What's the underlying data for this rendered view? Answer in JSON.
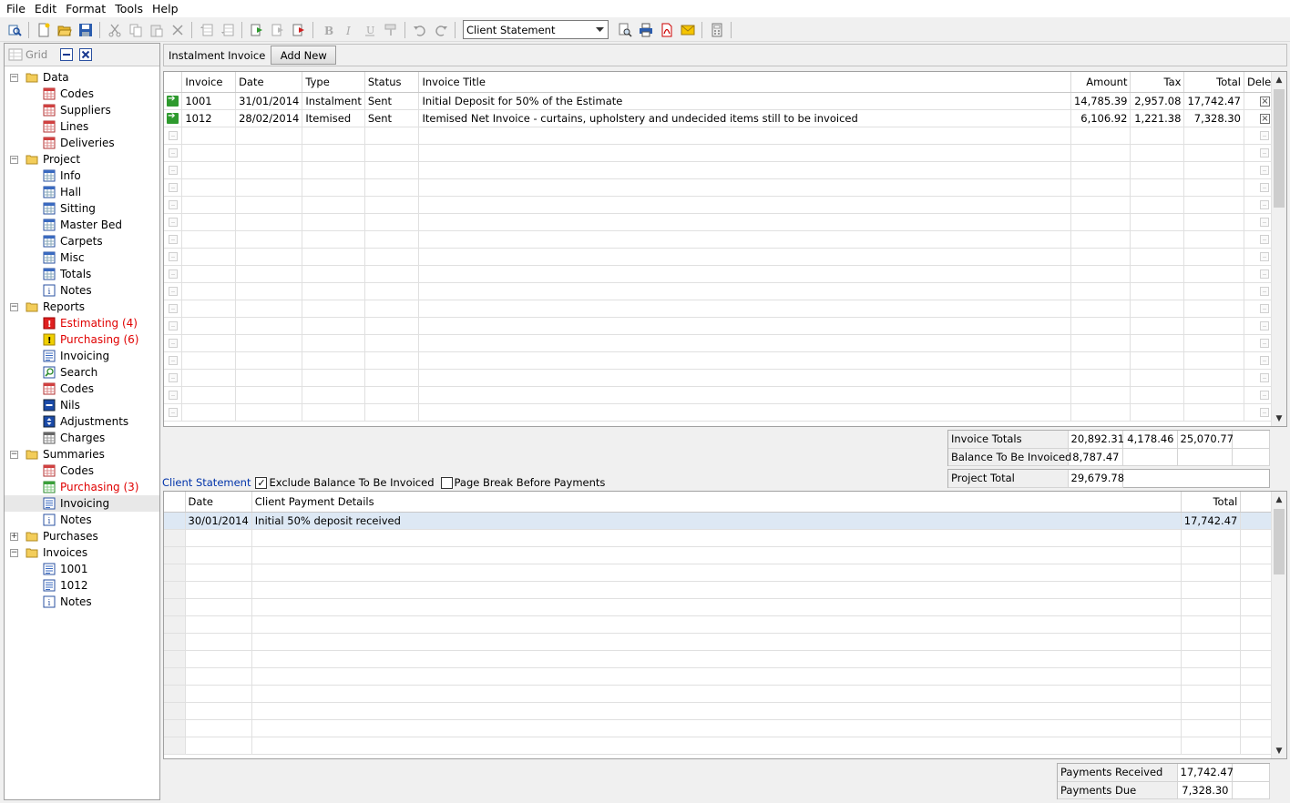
{
  "menu": [
    "File",
    "Edit",
    "Format",
    "Tools",
    "Help"
  ],
  "toolbar": {
    "report_select": "Client Statement"
  },
  "left": {
    "grid_label": "Grid",
    "tree": [
      {
        "label": "Data",
        "level": 0,
        "exp": "-",
        "icon": "folder"
      },
      {
        "label": "Codes",
        "level": 1,
        "icon": "red-grid"
      },
      {
        "label": "Suppliers",
        "level": 1,
        "icon": "red-grid"
      },
      {
        "label": "Lines",
        "level": 1,
        "icon": "red-grid"
      },
      {
        "label": "Deliveries",
        "level": 1,
        "icon": "red-grid"
      },
      {
        "label": "Project",
        "level": 0,
        "exp": "-",
        "icon": "folder"
      },
      {
        "label": "Info",
        "level": 1,
        "icon": "blue-grid"
      },
      {
        "label": "Hall",
        "level": 1,
        "icon": "blue-grid"
      },
      {
        "label": "Sitting",
        "level": 1,
        "icon": "blue-grid"
      },
      {
        "label": "Master Bed",
        "level": 1,
        "icon": "blue-grid"
      },
      {
        "label": "Carpets",
        "level": 1,
        "icon": "blue-grid"
      },
      {
        "label": "Misc",
        "level": 1,
        "icon": "blue-grid"
      },
      {
        "label": "Totals",
        "level": 1,
        "icon": "blue-grid"
      },
      {
        "label": "Notes",
        "level": 1,
        "icon": "info"
      },
      {
        "label": "Reports",
        "level": 0,
        "exp": "-",
        "icon": "folder"
      },
      {
        "label": "Estimating (4)",
        "level": 1,
        "icon": "red-alert",
        "red": true
      },
      {
        "label": "Purchasing (6)",
        "level": 1,
        "icon": "yellow-alert",
        "red": true
      },
      {
        "label": "Invoicing",
        "level": 1,
        "icon": "doc"
      },
      {
        "label": "Search",
        "level": 1,
        "icon": "search"
      },
      {
        "label": "Codes",
        "level": 1,
        "icon": "red-grid"
      },
      {
        "label": "Nils",
        "level": 1,
        "icon": "nil"
      },
      {
        "label": "Adjustments",
        "level": 1,
        "icon": "adjust"
      },
      {
        "label": "Charges",
        "level": 1,
        "icon": "gray-grid"
      },
      {
        "label": "Summaries",
        "level": 0,
        "exp": "-",
        "icon": "folder"
      },
      {
        "label": "Codes",
        "level": 1,
        "icon": "red-grid"
      },
      {
        "label": "Purchasing (3)",
        "level": 1,
        "icon": "green-grid",
        "red": true
      },
      {
        "label": "Invoicing",
        "level": 1,
        "icon": "doc",
        "selected": true
      },
      {
        "label": "Notes",
        "level": 1,
        "icon": "info"
      },
      {
        "label": "Purchases",
        "level": 0,
        "exp": "+",
        "icon": "folder"
      },
      {
        "label": "Invoices",
        "level": 0,
        "exp": "-",
        "icon": "folder"
      },
      {
        "label": "1001",
        "level": 1,
        "icon": "doc"
      },
      {
        "label": "1012",
        "level": 1,
        "icon": "doc"
      },
      {
        "label": "Notes",
        "level": 1,
        "icon": "info"
      }
    ]
  },
  "invoices": {
    "type_label": "Instalment Invoice",
    "add_label": "Add New",
    "columns": [
      "Invoice",
      "Date",
      "Type",
      "Status",
      "Invoice Title",
      "Amount",
      "Tax",
      "Total",
      "Delete"
    ],
    "rows": [
      {
        "invoice": "1001",
        "date": "31/01/2014",
        "type": "Instalment",
        "status": "Sent",
        "title": "Initial Deposit for 50% of the Estimate",
        "amount": "14,785.39",
        "tax": "2,957.08",
        "total": "17,742.47"
      },
      {
        "invoice": "1012",
        "date": "28/02/2014",
        "type": "Itemised",
        "status": "Sent",
        "title": "Itemised Net Invoice - curtains, upholstery and undecided items still to be invoiced",
        "amount": "6,106.92",
        "tax": "1,221.38",
        "total": "7,328.30"
      }
    ],
    "empty_rows": 17
  },
  "totals": {
    "invoice_totals_label": "Invoice Totals",
    "invoice_totals": [
      "20,892.31",
      "4,178.46",
      "25,070.77"
    ],
    "balance_label": "Balance To Be Invoiced",
    "balance": "8,787.47",
    "project_label": "Project Total",
    "project_total": "29,679.78"
  },
  "statement": {
    "link": "Client Statement",
    "opt_exclude": "Exclude Balance To Be Invoiced",
    "opt_pagebreak": "Page Break Before Payments",
    "columns": [
      "Date",
      "Client Payment Details",
      "Total"
    ],
    "rows": [
      {
        "date": "30/01/2014",
        "details": "Initial 50% deposit received",
        "total": "17,742.47"
      }
    ],
    "empty_rows": 13
  },
  "payments": {
    "received_label": "Payments Received",
    "received": "17,742.47",
    "due_label": "Payments Due",
    "due": "7,328.30"
  }
}
